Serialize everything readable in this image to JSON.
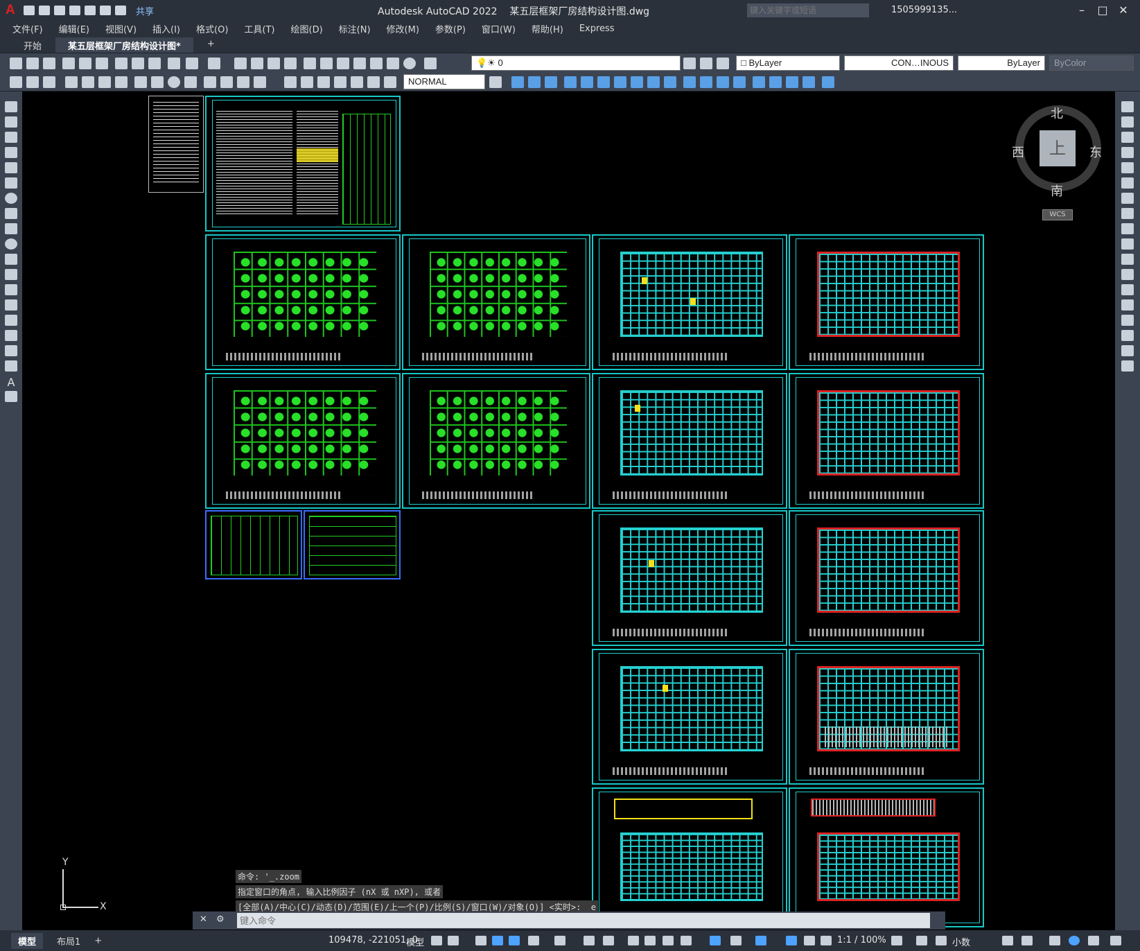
{
  "title": {
    "app": "Autodesk AutoCAD 2022",
    "file": "某五层框架厂房结构设计图.dwg",
    "share": "共享",
    "search_placeholder": "键入关键字或短语",
    "user": "1505999135..."
  },
  "menu": [
    "文件(F)",
    "编辑(E)",
    "视图(V)",
    "插入(I)",
    "格式(O)",
    "工具(T)",
    "绘图(D)",
    "标注(N)",
    "修改(M)",
    "参数(P)",
    "窗口(W)",
    "帮助(H)",
    "Express"
  ],
  "tabs": {
    "start": "开始",
    "drawing": "某五层框架厂房结构设计图*",
    "add": "+"
  },
  "toolbar": {
    "layer": "0",
    "color": "ByLayer",
    "linetype": "CON…INOUS",
    "lineweight": "ByLayer",
    "plotstyle": "ByColor",
    "dimstyle": "NORMAL"
  },
  "viewcube": {
    "north": "北",
    "south": "南",
    "east": "东",
    "west": "西",
    "top": "上",
    "wcs": "WCS"
  },
  "ucs": {
    "y": "Y",
    "x": "X"
  },
  "command": {
    "history": [
      "命令: '_.zoom",
      "指定窗口的角点, 输入比例因子 (nX 或 nXP), 或者",
      "[全部(A)/中心(C)/动态(D)/范围(E)/上一个(P)/比例(S)/窗口(W)/对象(O)] <实时>: _e"
    ],
    "placeholder": "键入命令"
  },
  "status": {
    "model_tab": "模型",
    "layout_tab": "布局1",
    "add": "+",
    "coords": "109478, -221051, 0",
    "model": "模型",
    "scale": "1:1 / 100%",
    "units": "小数"
  },
  "colors": {
    "cyan": "#16c8c8",
    "green": "#1ec51e",
    "red": "#d22222",
    "yellow": "#f5e11a",
    "chrome": "#3c4452"
  }
}
